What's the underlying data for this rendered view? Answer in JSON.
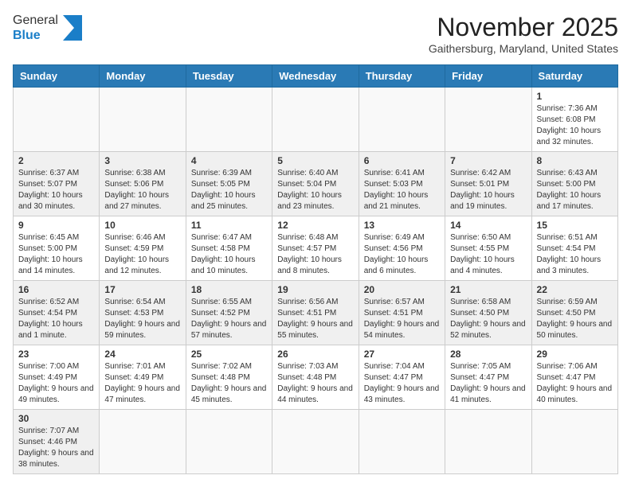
{
  "header": {
    "logo_general": "General",
    "logo_blue": "Blue",
    "month_year": "November 2025",
    "location": "Gaithersburg, Maryland, United States"
  },
  "weekdays": [
    "Sunday",
    "Monday",
    "Tuesday",
    "Wednesday",
    "Thursday",
    "Friday",
    "Saturday"
  ],
  "weeks": [
    [
      {
        "day": "",
        "info": ""
      },
      {
        "day": "",
        "info": ""
      },
      {
        "day": "",
        "info": ""
      },
      {
        "day": "",
        "info": ""
      },
      {
        "day": "",
        "info": ""
      },
      {
        "day": "",
        "info": ""
      },
      {
        "day": "1",
        "info": "Sunrise: 7:36 AM\nSunset: 6:08 PM\nDaylight: 10 hours and 32 minutes."
      }
    ],
    [
      {
        "day": "2",
        "info": "Sunrise: 6:37 AM\nSunset: 5:07 PM\nDaylight: 10 hours and 30 minutes."
      },
      {
        "day": "3",
        "info": "Sunrise: 6:38 AM\nSunset: 5:06 PM\nDaylight: 10 hours and 27 minutes."
      },
      {
        "day": "4",
        "info": "Sunrise: 6:39 AM\nSunset: 5:05 PM\nDaylight: 10 hours and 25 minutes."
      },
      {
        "day": "5",
        "info": "Sunrise: 6:40 AM\nSunset: 5:04 PM\nDaylight: 10 hours and 23 minutes."
      },
      {
        "day": "6",
        "info": "Sunrise: 6:41 AM\nSunset: 5:03 PM\nDaylight: 10 hours and 21 minutes."
      },
      {
        "day": "7",
        "info": "Sunrise: 6:42 AM\nSunset: 5:01 PM\nDaylight: 10 hours and 19 minutes."
      },
      {
        "day": "8",
        "info": "Sunrise: 6:43 AM\nSunset: 5:00 PM\nDaylight: 10 hours and 17 minutes."
      }
    ],
    [
      {
        "day": "9",
        "info": "Sunrise: 6:45 AM\nSunset: 5:00 PM\nDaylight: 10 hours and 14 minutes."
      },
      {
        "day": "10",
        "info": "Sunrise: 6:46 AM\nSunset: 4:59 PM\nDaylight: 10 hours and 12 minutes."
      },
      {
        "day": "11",
        "info": "Sunrise: 6:47 AM\nSunset: 4:58 PM\nDaylight: 10 hours and 10 minutes."
      },
      {
        "day": "12",
        "info": "Sunrise: 6:48 AM\nSunset: 4:57 PM\nDaylight: 10 hours and 8 minutes."
      },
      {
        "day": "13",
        "info": "Sunrise: 6:49 AM\nSunset: 4:56 PM\nDaylight: 10 hours and 6 minutes."
      },
      {
        "day": "14",
        "info": "Sunrise: 6:50 AM\nSunset: 4:55 PM\nDaylight: 10 hours and 4 minutes."
      },
      {
        "day": "15",
        "info": "Sunrise: 6:51 AM\nSunset: 4:54 PM\nDaylight: 10 hours and 3 minutes."
      }
    ],
    [
      {
        "day": "16",
        "info": "Sunrise: 6:52 AM\nSunset: 4:54 PM\nDaylight: 10 hours and 1 minute."
      },
      {
        "day": "17",
        "info": "Sunrise: 6:54 AM\nSunset: 4:53 PM\nDaylight: 9 hours and 59 minutes."
      },
      {
        "day": "18",
        "info": "Sunrise: 6:55 AM\nSunset: 4:52 PM\nDaylight: 9 hours and 57 minutes."
      },
      {
        "day": "19",
        "info": "Sunrise: 6:56 AM\nSunset: 4:51 PM\nDaylight: 9 hours and 55 minutes."
      },
      {
        "day": "20",
        "info": "Sunrise: 6:57 AM\nSunset: 4:51 PM\nDaylight: 9 hours and 54 minutes."
      },
      {
        "day": "21",
        "info": "Sunrise: 6:58 AM\nSunset: 4:50 PM\nDaylight: 9 hours and 52 minutes."
      },
      {
        "day": "22",
        "info": "Sunrise: 6:59 AM\nSunset: 4:50 PM\nDaylight: 9 hours and 50 minutes."
      }
    ],
    [
      {
        "day": "23",
        "info": "Sunrise: 7:00 AM\nSunset: 4:49 PM\nDaylight: 9 hours and 49 minutes."
      },
      {
        "day": "24",
        "info": "Sunrise: 7:01 AM\nSunset: 4:49 PM\nDaylight: 9 hours and 47 minutes."
      },
      {
        "day": "25",
        "info": "Sunrise: 7:02 AM\nSunset: 4:48 PM\nDaylight: 9 hours and 45 minutes."
      },
      {
        "day": "26",
        "info": "Sunrise: 7:03 AM\nSunset: 4:48 PM\nDaylight: 9 hours and 44 minutes."
      },
      {
        "day": "27",
        "info": "Sunrise: 7:04 AM\nSunset: 4:47 PM\nDaylight: 9 hours and 43 minutes."
      },
      {
        "day": "28",
        "info": "Sunrise: 7:05 AM\nSunset: 4:47 PM\nDaylight: 9 hours and 41 minutes."
      },
      {
        "day": "29",
        "info": "Sunrise: 7:06 AM\nSunset: 4:47 PM\nDaylight: 9 hours and 40 minutes."
      }
    ],
    [
      {
        "day": "30",
        "info": "Sunrise: 7:07 AM\nSunset: 4:46 PM\nDaylight: 9 hours and 38 minutes."
      },
      {
        "day": "",
        "info": ""
      },
      {
        "day": "",
        "info": ""
      },
      {
        "day": "",
        "info": ""
      },
      {
        "day": "",
        "info": ""
      },
      {
        "day": "",
        "info": ""
      },
      {
        "day": "",
        "info": ""
      }
    ]
  ]
}
